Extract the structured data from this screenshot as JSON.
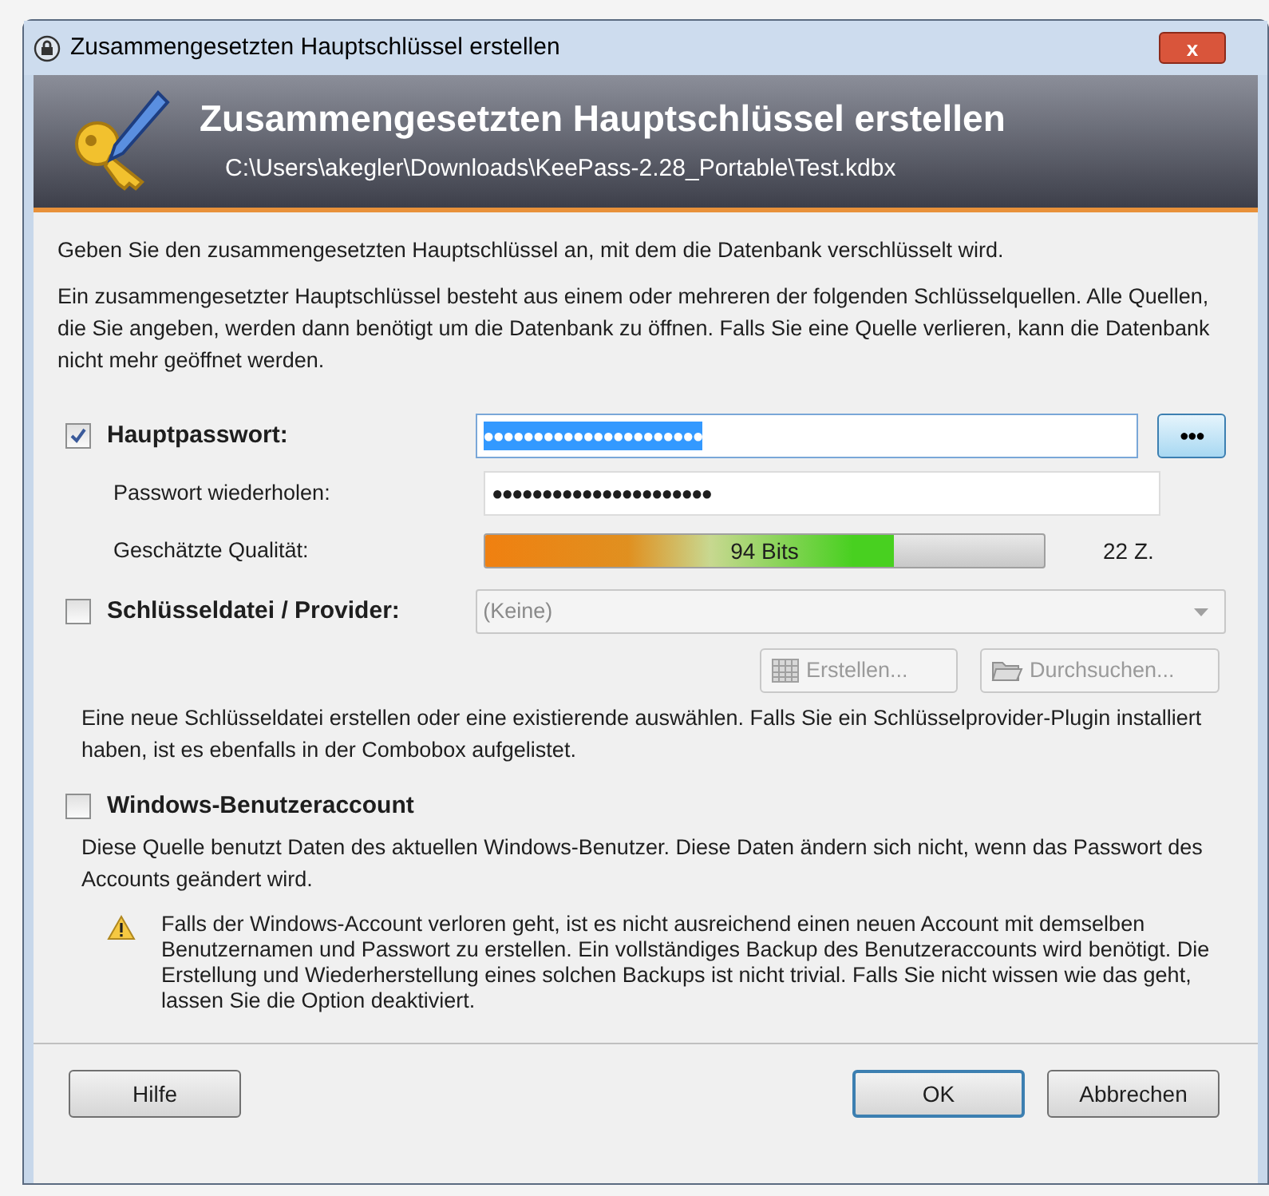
{
  "window": {
    "title": "Zusammengesetzten Hauptschlüssel erstellen",
    "close_label": "x"
  },
  "banner": {
    "title": "Zusammengesetzten Hauptschlüssel erstellen",
    "path": "C:\\Users\\akegler\\Downloads\\KeePass-2.28_Portable\\Test.kdbx"
  },
  "intro": [
    "Geben Sie den zusammengesetzten Hauptschlüssel an, mit dem die Datenbank verschlüsselt wird.",
    "Ein zusammengesetzter Hauptschlüssel besteht aus einem oder mehreren der folgenden Schlüsselquellen. Alle Quellen, die Sie angeben, werden dann benötigt um die Datenbank zu öffnen. Falls Sie eine Quelle verlieren, kann die Datenbank nicht mehr geöffnet werden."
  ],
  "master_password": {
    "label": "Hauptpasswort:",
    "checked": true,
    "value": "●●●●●●●●●●●●●●●●●●●●●●",
    "text_selected": true,
    "toggle_label": "●●●",
    "repeat_label": "Passwort wiederholen:",
    "repeat_value": "●●●●●●●●●●●●●●●●●●●●●●",
    "quality_label": "Geschätzte Qualität:",
    "quality": {
      "level": 0.73,
      "reading": "94 Bits"
    },
    "length": "22 Z."
  },
  "key_file": {
    "label": "Schlüsseldatei / Provider:",
    "checked": false,
    "combo_value": "(Keine)",
    "disabled": true,
    "buttons": [
      {
        "label": "Erstellen...",
        "kind": "create",
        "disabled": true
      },
      {
        "label": "Durchsuchen...",
        "kind": "browse",
        "disabled": true
      }
    ],
    "description": "Eine neue Schlüsseldatei erstellen oder eine existierende auswählen. Falls Sie ein Schlüsselprovider-Plugin installiert haben, ist es ebenfalls in der Combobox aufgelistet."
  },
  "windows_account": {
    "label": "Windows-Benutzeraccount",
    "checked": false,
    "description": "Diese Quelle benutzt Daten des aktuellen Windows-Benutzer. Diese Daten ändern sich nicht, wenn das Passwort des Accounts geändert wird.",
    "warning": "Falls der Windows-Account verloren geht, ist es nicht ausreichend einen neuen Account mit demselben Benutzernamen und Passwort zu erstellen. Ein vollständiges Backup des Benutzeraccounts wird benötigt. Die Erstellung und Wiederherstellung eines solchen Backups ist nicht trivial. Falls Sie nicht wissen wie das geht, lassen Sie die Option deaktiviert."
  },
  "buttons": [
    {
      "label": "Hilfe",
      "default": false
    },
    {
      "label": "OK",
      "default": true
    },
    {
      "label": "Abbrechen",
      "default": false
    }
  ]
}
